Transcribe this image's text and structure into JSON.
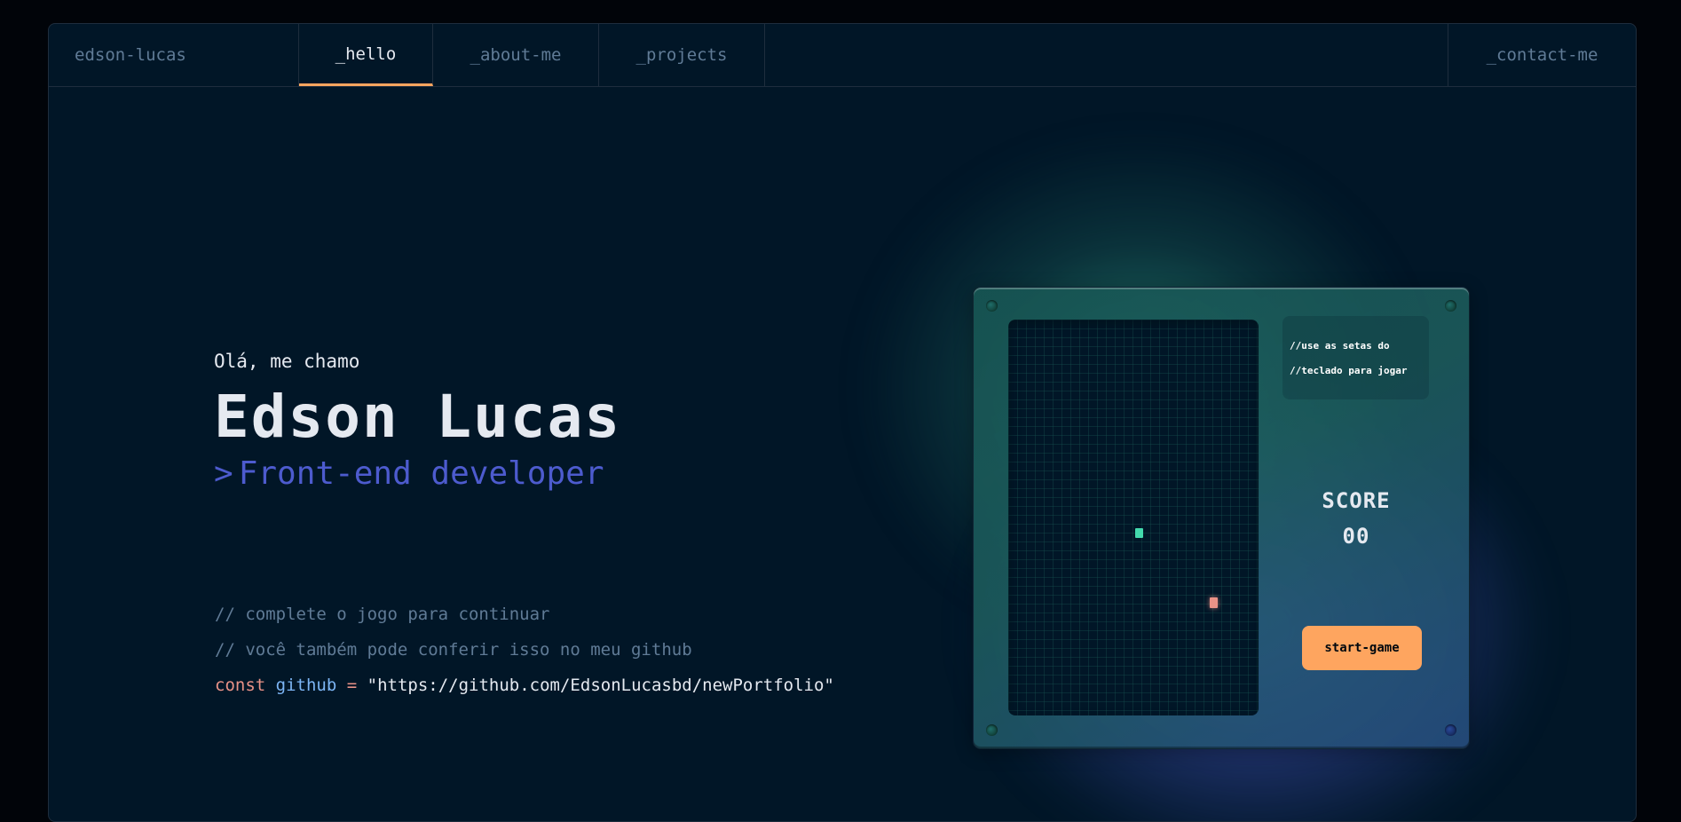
{
  "nav": {
    "brand": "edson-lucas",
    "tabs": [
      {
        "label": "_hello",
        "active": true
      },
      {
        "label": "_about-me",
        "active": false
      },
      {
        "label": "_projects",
        "active": false
      }
    ],
    "contact": "_contact-me"
  },
  "hero": {
    "greeting": "Olá, me chamo",
    "name": "Edson Lucas",
    "caret": ">",
    "role": "Front-end developer"
  },
  "comments": {
    "line1": "// complete o jogo para continuar",
    "line2": "// você também pode conferir isso no meu github",
    "code": {
      "keyword": "const",
      "variable": "github",
      "equals": "=",
      "value": "\"https://github.com/EdsonLucasbd/newPortfolio\""
    }
  },
  "game": {
    "instructions": [
      "//use as setas do",
      "//teclado para jogar"
    ],
    "score_label": "SCORE",
    "score_value": "00",
    "start_button": "start-game"
  },
  "colors": {
    "background": "#011627",
    "accent_orange": "#FEA55F",
    "accent_green": "#43D9AD",
    "accent_purple": "#4D5BCE",
    "accent_pink": "#E99287",
    "muted_text": "#607B96"
  }
}
